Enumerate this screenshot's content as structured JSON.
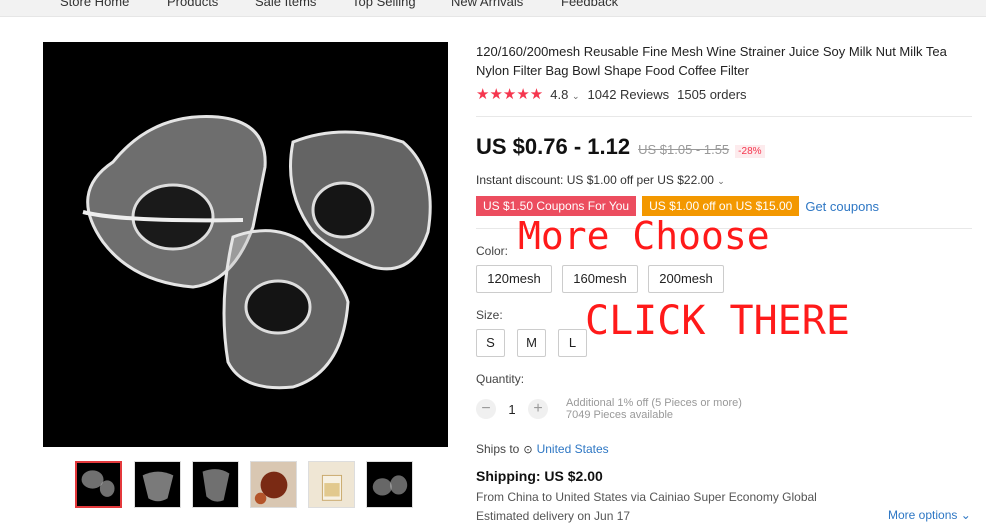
{
  "nav": {
    "items": [
      "Store Home",
      "Products",
      "Sale Items",
      "Top Selling",
      "New Arrivals",
      "Feedback"
    ]
  },
  "product": {
    "title": "120/160/200mesh Reusable Fine Mesh Wine Strainer Juice Soy Milk Nut Milk Tea Nylon Filter Bag Bowl Shape Food Coffee Filter",
    "stars": "★★★★★",
    "rating": "4.8",
    "reviews": "1042 Reviews",
    "orders": "1505 orders",
    "price": "US $0.76 - 1.12",
    "old_price": "US $1.05 - 1.55",
    "discount": "-28%",
    "instant_discount": "Instant discount: US $1.00 off per US $22.00",
    "coupons": [
      "US $1.50 Coupons For You",
      "US $1.00 off on US $15.00"
    ],
    "get_coupons": "Get coupons",
    "color_label": "Color:",
    "colors": [
      "120mesh",
      "160mesh",
      "200mesh"
    ],
    "size_label": "Size:",
    "sizes": [
      "S",
      "M",
      "L"
    ],
    "quantity_label": "Quantity:",
    "quantity": "1",
    "qty_note_1": "Additional 1% off (5 Pieces or more)",
    "qty_note_2": "7049 Pieces available",
    "ships_to_label": "Ships to",
    "ships_to_country": "United States",
    "shipping": "Shipping: US $2.00",
    "ship_from": "From China to United States via Cainiao Super Economy Global",
    "delivery": "Estimated delivery on Jun 17",
    "more_options": "More options"
  },
  "overlay": {
    "more_choose": "More Choose",
    "click_there": "CLICK THERE"
  },
  "colors": {
    "accent_red": "#f5364e",
    "coupon_red": "#ec4d5f",
    "coupon_orange": "#f39800",
    "link_blue": "#2e77c4",
    "overlay_red": "#ff1a1a"
  }
}
